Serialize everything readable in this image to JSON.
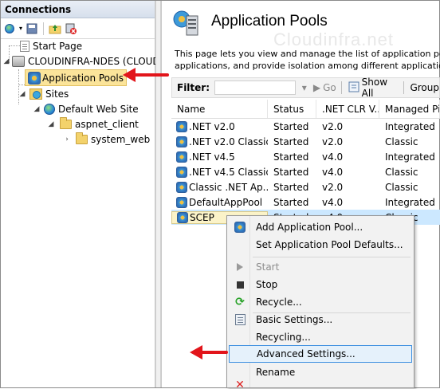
{
  "connections": {
    "header": "Connections",
    "tree": {
      "start_page": "Start Page",
      "server": "CLOUDINFRA-NDES (CLOUDI",
      "app_pools": "Application Pools",
      "sites": "Sites",
      "default_site": "Default Web Site",
      "aspnet_client": "aspnet_client",
      "system_web": "system_web"
    }
  },
  "main": {
    "title": "Application Pools",
    "watermark": "Cloudinfra.net",
    "description_line1": "This page lets you view and manage the list of application pool",
    "description_line2": "applications, and provide isolation among different application",
    "filter_label": "Filter:",
    "go_label": "Go",
    "show_all_label": "Show All",
    "group_label": "Group",
    "columns": {
      "name": "Name",
      "status": "Status",
      "clr": ".NET CLR V...",
      "pipeline": "Managed Pip"
    },
    "rows": [
      {
        "name": ".NET v2.0",
        "status": "Started",
        "clr": "v2.0",
        "pipeline": "Integrated"
      },
      {
        "name": ".NET v2.0 Classic",
        "status": "Started",
        "clr": "v2.0",
        "pipeline": "Classic"
      },
      {
        "name": ".NET v4.5",
        "status": "Started",
        "clr": "v4.0",
        "pipeline": "Integrated"
      },
      {
        "name": ".NET v4.5 Classic",
        "status": "Started",
        "clr": "v4.0",
        "pipeline": "Classic"
      },
      {
        "name": "Classic .NET Ap...",
        "status": "Started",
        "clr": "v2.0",
        "pipeline": "Classic"
      },
      {
        "name": "DefaultAppPool",
        "status": "Started",
        "clr": "v4.0",
        "pipeline": "Integrated"
      },
      {
        "name": "SCEP",
        "status": "Started",
        "clr": "v4.0",
        "pipeline": "Classic"
      }
    ]
  },
  "context_menu": {
    "add_pool": "Add Application Pool...",
    "set_defaults": "Set Application Pool Defaults...",
    "start": "Start",
    "stop": "Stop",
    "recycle": "Recycle...",
    "basic_settings": "Basic Settings...",
    "recycling": "Recycling...",
    "advanced_settings": "Advanced Settings...",
    "rename": "Rename"
  },
  "colors": {
    "annotation_arrow": "#e2151b",
    "selection_highlight": "#fbe49a",
    "menu_hover_border": "#3b8ee0"
  }
}
